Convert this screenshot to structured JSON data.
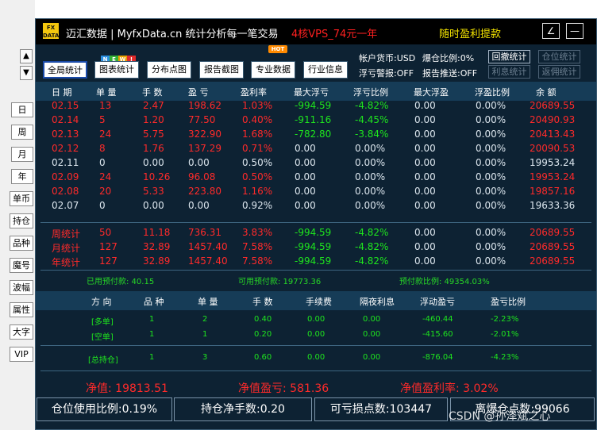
{
  "sidebar": {
    "up": "▲",
    "down": "▼",
    "items": [
      "日",
      "周",
      "月",
      "年",
      "单币",
      "持仓",
      "品种",
      "魔号",
      "波幅",
      "属性",
      "大字",
      "VIP"
    ]
  },
  "titlebar": {
    "logo_top": "FX",
    "logo_bottom": "DATA",
    "app": "迈汇数据 | MyfxData.cn   统计分析每一笔交易",
    "promo1": "4核VPS_74元一年",
    "promo2": "随时盈利提款",
    "btn1": "∠",
    "btn2": "—"
  },
  "toolbar": {
    "buttons": [
      "全局统计",
      "图表统计",
      "分布点图",
      "报告截图",
      "专业数据",
      "行业信息"
    ],
    "new_badge": [
      "N",
      "E",
      "W",
      "!"
    ],
    "hot_badge": "HOT"
  },
  "account": {
    "currency": "帐户货币:USD",
    "hedge_ratio": "爆仓比例:0%",
    "float_alert": "浮亏警报:OFF",
    "report_push": "报告推送:OFF",
    "btns": [
      "回撤统计",
      "仓位统计",
      "利息统计",
      "返佣统计"
    ]
  },
  "table1": {
    "headers": [
      "日 期",
      "单 量",
      "手 数",
      "盈 亏",
      "盈利率",
      "最大浮亏",
      "浮亏比例",
      "最大浮盈",
      "浮盈比例",
      "余 额"
    ],
    "rows": [
      {
        "c": "red",
        "v": [
          "02.15",
          "13",
          "2.47",
          "198.62",
          "1.03%",
          "-994.59",
          "-4.82%",
          "0.00",
          "0.00%",
          "20689.55"
        ]
      },
      {
        "c": "red",
        "v": [
          "02.14",
          "5",
          "1.20",
          "77.50",
          "0.40%",
          "-911.16",
          "-4.45%",
          "0.00",
          "0.00%",
          "20490.93"
        ]
      },
      {
        "c": "red",
        "v": [
          "02.13",
          "24",
          "5.75",
          "322.90",
          "1.68%",
          "-782.80",
          "-3.84%",
          "0.00",
          "0.00%",
          "20413.43"
        ]
      },
      {
        "c": "red",
        "v": [
          "02.12",
          "8",
          "1.76",
          "137.29",
          "0.71%",
          "0.00",
          "0.00%",
          "0.00",
          "0.00%",
          "20090.53"
        ]
      },
      {
        "c": "wht",
        "v": [
          "02.11",
          "0",
          "0.00",
          "0.00",
          "0.50%",
          "0.00",
          "0.00%",
          "0.00",
          "0.00%",
          "19953.24"
        ]
      },
      {
        "c": "red",
        "v": [
          "02.09",
          "24",
          "10.26",
          "96.08",
          "0.50%",
          "0.00",
          "0.00%",
          "0.00",
          "0.00%",
          "19953.24"
        ]
      },
      {
        "c": "red",
        "v": [
          "02.08",
          "20",
          "5.33",
          "223.80",
          "1.16%",
          "0.00",
          "0.00%",
          "0.00",
          "0.00%",
          "19857.16"
        ]
      },
      {
        "c": "wht",
        "v": [
          "02.07",
          "0",
          "0.00",
          "0.00",
          "0.92%",
          "0.00",
          "0.00%",
          "0.00",
          "0.00%",
          "19633.36"
        ]
      }
    ],
    "summary": [
      {
        "v": [
          "周统计",
          "50",
          "11.18",
          "736.31",
          "3.83%",
          "-994.59",
          "-4.82%",
          "0.00",
          "0.00%",
          "20689.55"
        ]
      },
      {
        "v": [
          "月统计",
          "127",
          "32.89",
          "1457.40",
          "7.58%",
          "-994.59",
          "-4.82%",
          "0.00",
          "0.00%",
          "20689.55"
        ]
      },
      {
        "v": [
          "年统计",
          "127",
          "32.89",
          "1457.40",
          "7.58%",
          "-994.59",
          "-4.82%",
          "0.00",
          "0.00%",
          "20689.55"
        ]
      }
    ]
  },
  "margin": {
    "used": "已用预付款: 40.15",
    "free": "可用预付款: 19773.36",
    "ratio": "预付款比例: 49354.03%"
  },
  "table2": {
    "headers": [
      "方 向",
      "品 种",
      "单 量",
      "手 数",
      "手续费",
      "隔夜利息",
      "浮动盈亏",
      "盈亏比例"
    ],
    "rows": [
      {
        "v": [
          "[多单]",
          "1",
          "2",
          "0.40",
          "0.00",
          "0.00",
          "-460.44",
          "-2.23%"
        ]
      },
      {
        "v": [
          "[空单]",
          "1",
          "1",
          "0.20",
          "0.00",
          "0.00",
          "-415.60",
          "-2.01%"
        ]
      }
    ],
    "total": {
      "v": [
        "[总持仓]",
        "1",
        "3",
        "0.60",
        "0.00",
        "0.00",
        "-876.04",
        "-4.23%"
      ]
    }
  },
  "equity": {
    "net": "净值: 19813.51",
    "pnl": "净值盈亏: 581.36",
    "rate": "净值盈利率: 3.02%"
  },
  "bottom": {
    "pos_ratio": "仓位使用比例:0.19%",
    "net_lots": "持仓净手数:0.20",
    "loss_points": "可亏损点数:103447",
    "margin_call": "离爆仓点数:99066"
  },
  "watermark": "CSDN @孙泽斌之心",
  "colors": {
    "bg": "#0d2233",
    "header_band": "#163c57",
    "red": "#ff2a2a",
    "green": "#1ee51e",
    "yellow": "#f2e200"
  }
}
